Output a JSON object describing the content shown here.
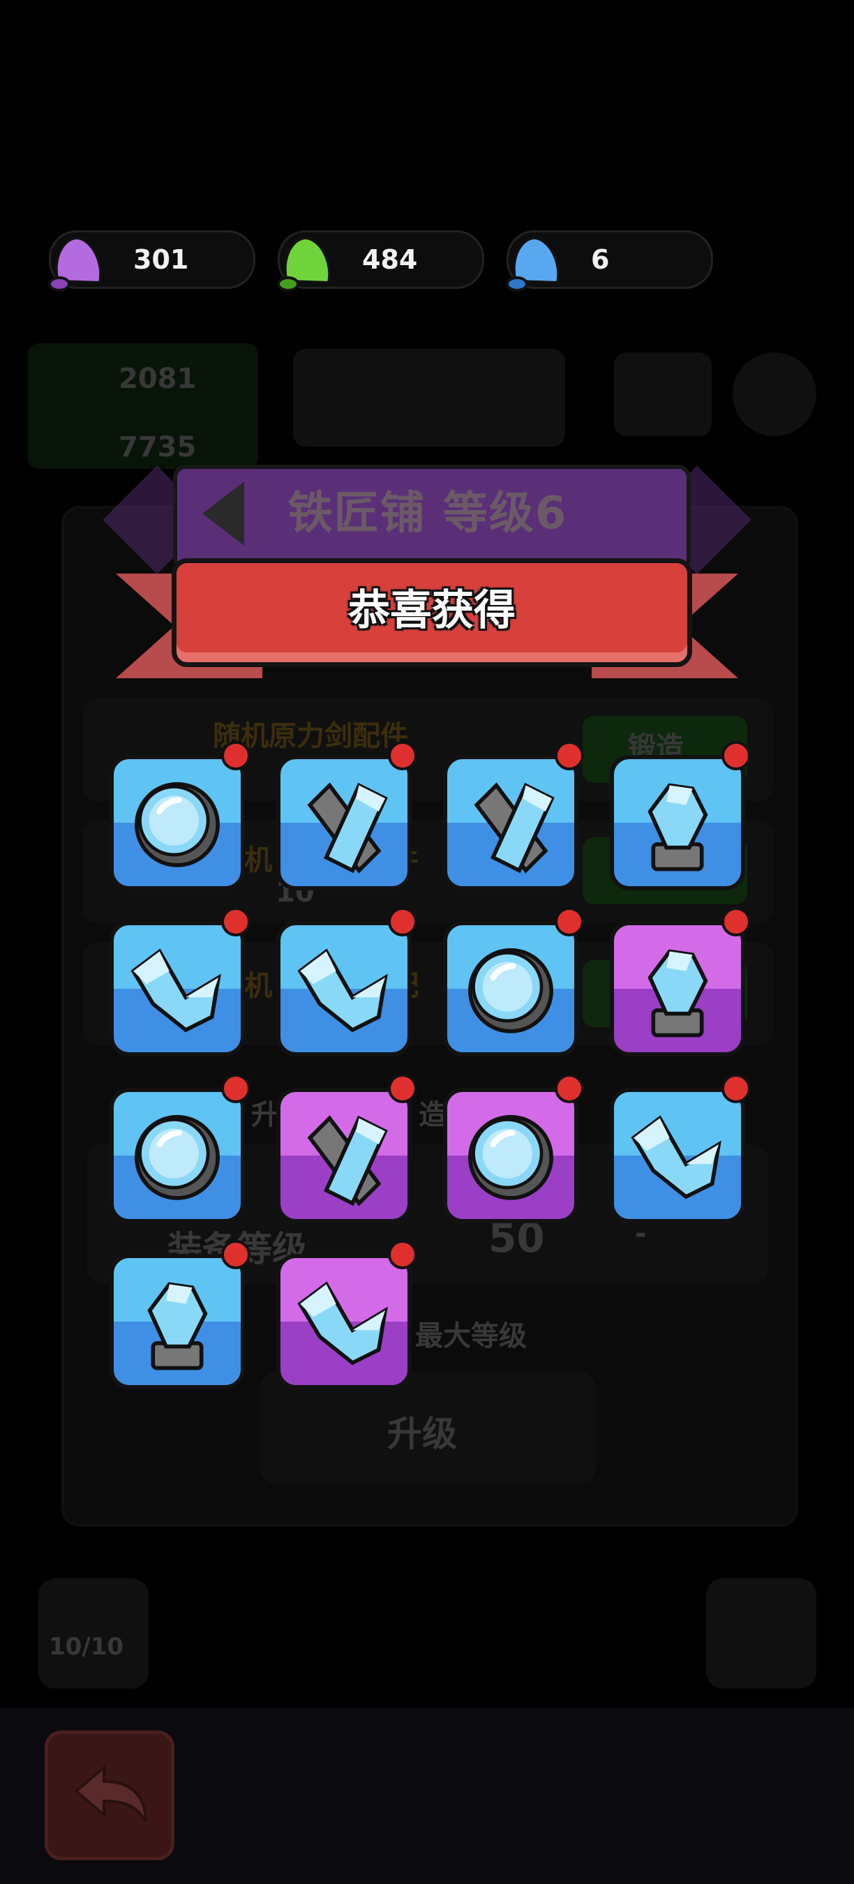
{
  "currencies": [
    {
      "name": "purple-gem",
      "value": "301",
      "color": "#b46be0"
    },
    {
      "name": "green-gem",
      "value": "484",
      "color": "#6fd43c"
    },
    {
      "name": "blue-gem",
      "value": "6",
      "color": "#58a8f0"
    }
  ],
  "header": {
    "value1": "2081",
    "value2": "7735"
  },
  "title": "铁匠铺  等级6",
  "popup": {
    "title": "恭喜获得"
  },
  "background_panel": {
    "row1_label": "随机原力剑配件",
    "row1_button": "锻造",
    "row2_label_partial": "机",
    "row2_label_suffix": "件",
    "row2_value": "10",
    "row3_label_partial": "机",
    "row3_label_suffix": "配",
    "upgrade_label_partial": "升",
    "upgrade_label_mid": "造",
    "equip_level_label": "装备等级",
    "equip_level_value": "50",
    "equip_level_next": "-",
    "max_level_label": "最大等级",
    "upgrade_button": "升级",
    "energy": "10/10"
  },
  "rewards": [
    {
      "icon": "lens-icon",
      "rarity": "blue"
    },
    {
      "icon": "sword-blade-icon",
      "rarity": "blue"
    },
    {
      "icon": "sword-blade-icon",
      "rarity": "blue"
    },
    {
      "icon": "crystal-pedestal-icon",
      "rarity": "blue"
    },
    {
      "icon": "crystal-shard-icon",
      "rarity": "blue"
    },
    {
      "icon": "crystal-shard-icon",
      "rarity": "blue"
    },
    {
      "icon": "lens-icon",
      "rarity": "blue"
    },
    {
      "icon": "crystal-pedestal-icon",
      "rarity": "purple"
    },
    {
      "icon": "lens-icon",
      "rarity": "blue"
    },
    {
      "icon": "sword-blade-icon",
      "rarity": "purple"
    },
    {
      "icon": "lens-icon",
      "rarity": "purple"
    },
    {
      "icon": "crystal-shard-icon",
      "rarity": "blue"
    },
    {
      "icon": "crystal-pedestal-icon",
      "rarity": "blue"
    },
    {
      "icon": "crystal-shard-icon",
      "rarity": "purple"
    }
  ],
  "bottom": {
    "back_icon": "back-arrow-icon"
  }
}
